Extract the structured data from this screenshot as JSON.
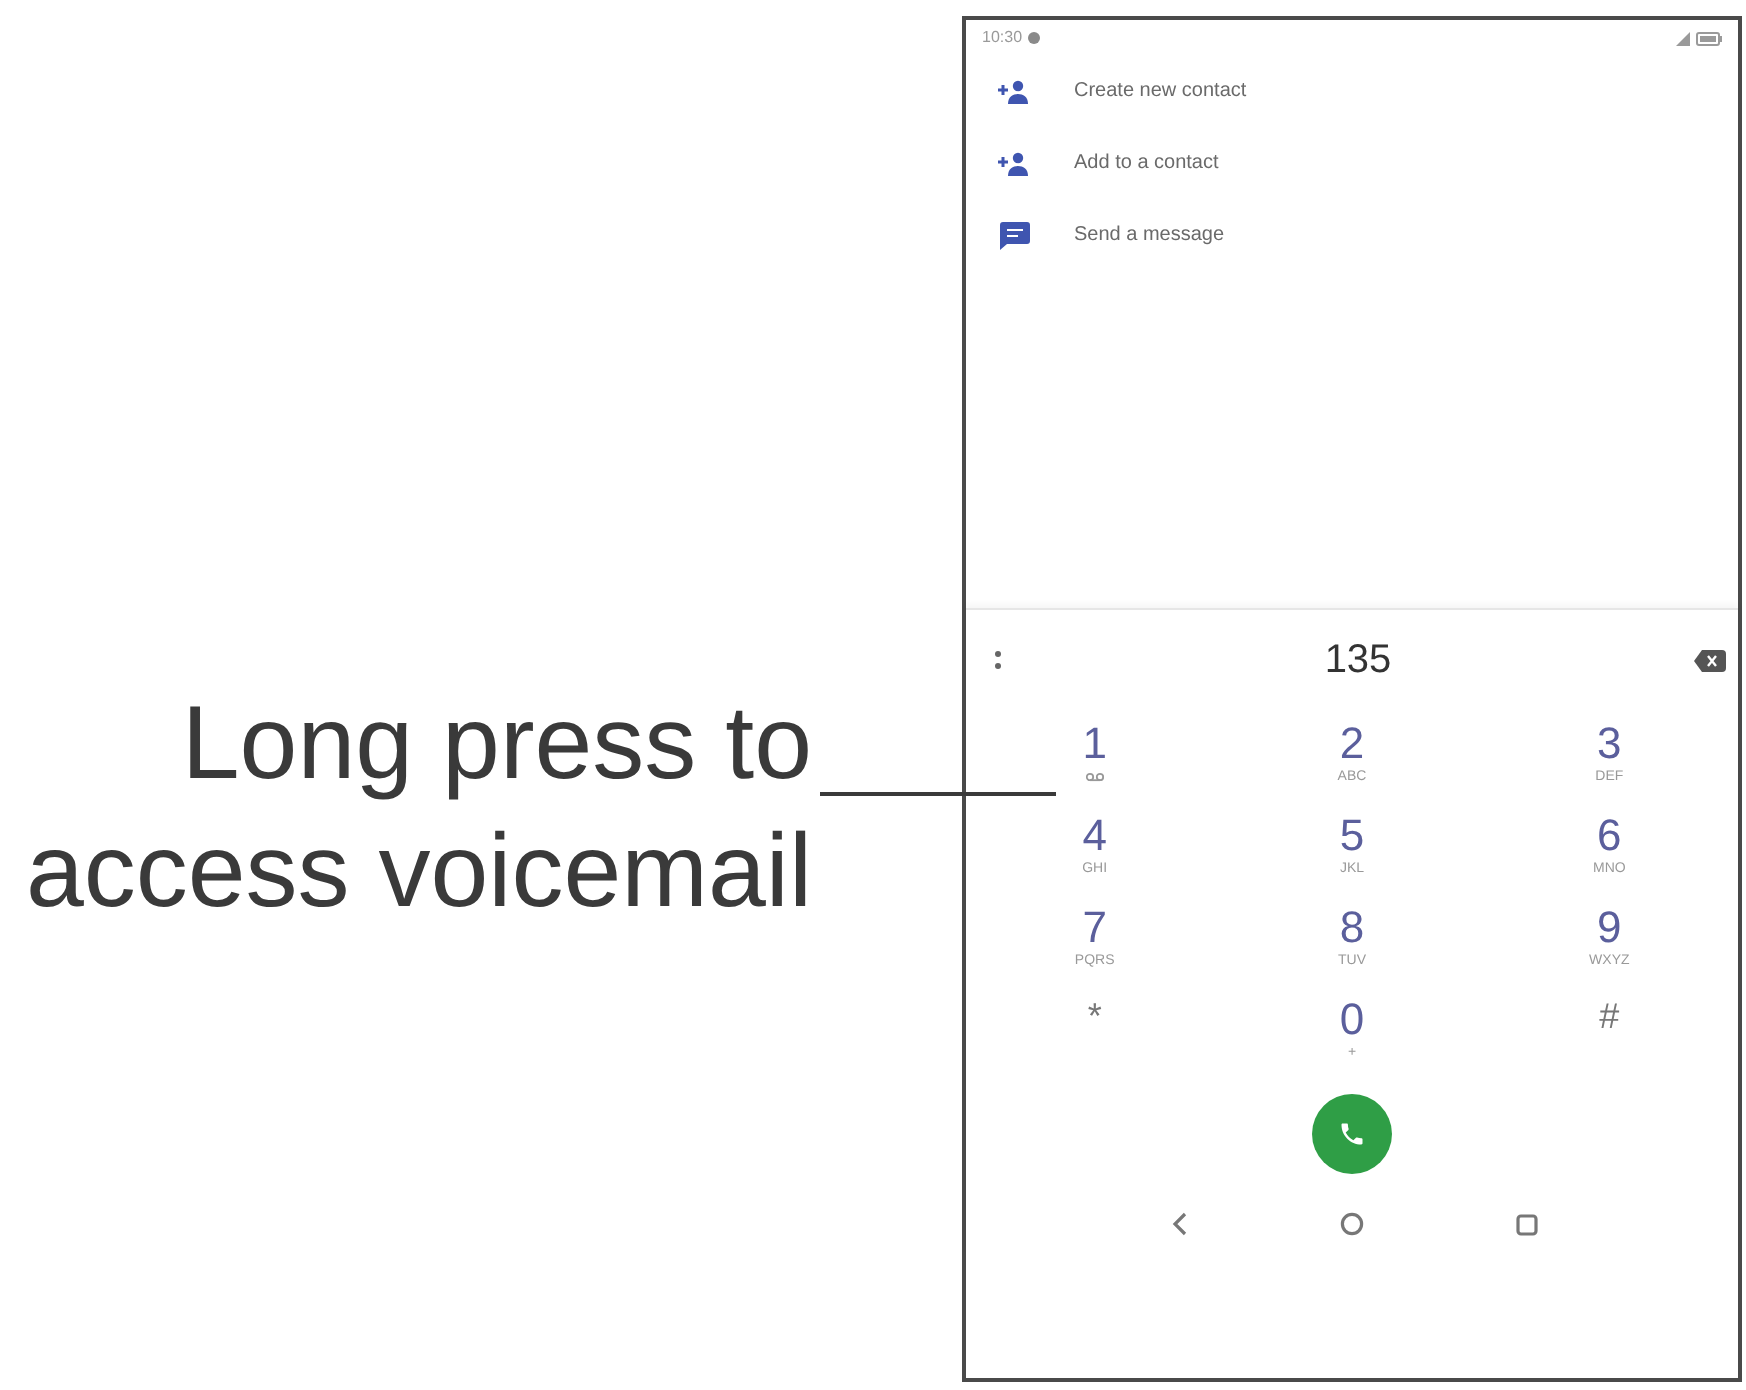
{
  "annotation": {
    "text": "Long press to access voicemail"
  },
  "status_bar": {
    "time": "10:30"
  },
  "actions": [
    {
      "kind": "add_person",
      "label": "Create new contact"
    },
    {
      "kind": "add_person",
      "label": "Add to a contact"
    },
    {
      "kind": "message",
      "label": "Send a message"
    }
  ],
  "dialer": {
    "number": "135",
    "keys": [
      {
        "kind": "voicemail",
        "digit": "1"
      },
      {
        "kind": "letters",
        "digit": "2",
        "letters": "ABC"
      },
      {
        "kind": "letters",
        "digit": "3",
        "letters": "DEF"
      },
      {
        "kind": "letters",
        "digit": "4",
        "letters": "GHI"
      },
      {
        "kind": "letters",
        "digit": "5",
        "letters": "JKL"
      },
      {
        "kind": "letters",
        "digit": "6",
        "letters": "MNO"
      },
      {
        "kind": "letters",
        "digit": "7",
        "letters": "PQRS"
      },
      {
        "kind": "letters",
        "digit": "8",
        "letters": "TUV"
      },
      {
        "kind": "letters",
        "digit": "9",
        "letters": "WXYZ"
      },
      {
        "kind": "symbol",
        "digit": "*"
      },
      {
        "kind": "letters",
        "digit": "0",
        "letters": "+"
      },
      {
        "kind": "symbol",
        "digit": "#"
      }
    ]
  }
}
